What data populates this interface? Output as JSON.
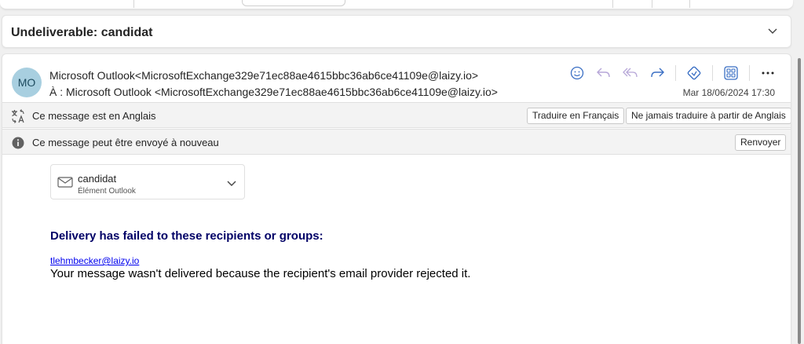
{
  "subject": "Undeliverable: candidat",
  "sender": {
    "avatar_initials": "MO",
    "from": "Microsoft Outlook<MicrosoftExchange329e71ec88ae4615bbc36ab6ce41109e@laizy.io>",
    "to": "À :  Microsoft Outlook <MicrosoftExchange329e71ec88ae4615bbc36ab6ce41109e@laizy.io>",
    "date": "Mar 18/06/2024 17:30"
  },
  "actions": [
    "emoji-icon",
    "reply-icon",
    "reply-all-icon",
    "forward-icon",
    "sticker-icon",
    "apps-icon",
    "more-icon"
  ],
  "translate_banner": {
    "text": "Ce message est en Anglais",
    "translate_button": "Traduire en Français",
    "never_button": "Ne jamais traduire à partir de Anglais"
  },
  "resend_banner": {
    "text": "Ce message peut être envoyé à nouveau",
    "resend_button": "Renvoyer"
  },
  "attachment": {
    "name": "candidat",
    "type": "Élément Outlook"
  },
  "body": {
    "headline": "Delivery has failed to these recipients or groups:",
    "recipient": "tlehmbecker@laizy.io",
    "message": "Your message wasn't delivered because the recipient's email provider rejected it."
  },
  "colors": {
    "accent": "#3a6fc4",
    "avatar_bg": "#a8cfe0",
    "headline": "#000066",
    "link": "#0000ee"
  }
}
